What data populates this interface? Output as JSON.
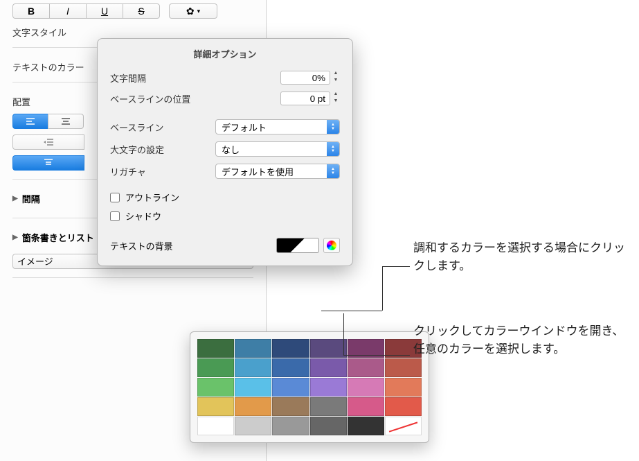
{
  "sidebar": {
    "char_style": "文字スタイル",
    "text_color": "テキストのカラー",
    "alignment": "配置",
    "spacing": "間隔",
    "bullets": "箇条書きとリスト",
    "bullets_value": "イメージ"
  },
  "popover": {
    "title": "詳細オプション",
    "char_spacing": "文字間隔",
    "char_spacing_value": "0%",
    "baseline_shift": "ベースラインの位置",
    "baseline_shift_value": "0 pt",
    "baseline": "ベースライン",
    "baseline_value": "デフォルト",
    "caps": "大文字の設定",
    "caps_value": "なし",
    "ligatures": "リガチャ",
    "ligatures_value": "デフォルトを使用",
    "outline": "アウトライン",
    "shadow": "シャドウ",
    "text_bg": "テキストの背景"
  },
  "callouts": {
    "swatch": "調和するカラーを選択する場合にクリックします。",
    "wheel": "クリックしてカラーウインドウを開き、任意のカラーを選択します。"
  },
  "palette": {
    "rows": [
      [
        "#3b6e3f",
        "#3e7ea6",
        "#2e4a7a",
        "#5a4a7e",
        "#7a3a6a",
        "#8a3a3a"
      ],
      [
        "#4a9a54",
        "#4aa0cc",
        "#3a6aaa",
        "#7a5aaa",
        "#aa5a8a",
        "#bb5a4a"
      ],
      [
        "#6ac26a",
        "#5ac0e8",
        "#5a8ad6",
        "#9a7ad6",
        "#d67ab6",
        "#e27a5a"
      ],
      [
        "#e2c45a",
        "#e29a4a",
        "#9a7a5a",
        "#7a7a7a",
        "#d65a8a",
        "#e25a4a"
      ],
      [
        "#ffffff",
        "#cccccc",
        "#999999",
        "#666666",
        "#333333",
        "none"
      ]
    ]
  }
}
